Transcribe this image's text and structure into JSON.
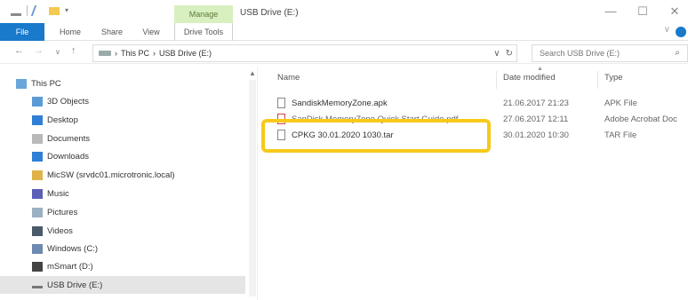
{
  "window": {
    "title": "USB Drive (E:)",
    "manage_tab": "Manage",
    "minimize": "—",
    "maximize": "☐",
    "close": "✕"
  },
  "ribbon": {
    "tabs": [
      "File",
      "Home",
      "Share",
      "View",
      "Drive Tools"
    ],
    "expand": "∨"
  },
  "address": {
    "crumbs": [
      "This PC",
      "USB Drive (E:)"
    ],
    "separator": "›",
    "dropdown": "∨",
    "refresh": "↻"
  },
  "search": {
    "placeholder": "Search USB Drive (E:)",
    "icon": "⌕"
  },
  "navigation": {
    "items": [
      {
        "label": "This PC",
        "icon": "this-pc-icon"
      },
      {
        "label": "3D Objects",
        "icon": "3d-objects-icon"
      },
      {
        "label": "Desktop",
        "icon": "desktop-icon"
      },
      {
        "label": "Documents",
        "icon": "documents-icon"
      },
      {
        "label": "Downloads",
        "icon": "downloads-icon"
      },
      {
        "label": "MicSW (srvdc01.microtronic.local)",
        "icon": "network-drive-icon"
      },
      {
        "label": "Music",
        "icon": "music-icon"
      },
      {
        "label": "Pictures",
        "icon": "pictures-icon"
      },
      {
        "label": "Videos",
        "icon": "videos-icon"
      },
      {
        "label": "Windows (C:)",
        "icon": "windows-drive-icon"
      },
      {
        "label": "mSmart (D:)",
        "icon": "drive-icon"
      },
      {
        "label": "USB Drive (E:)",
        "icon": "usb-drive-icon"
      }
    ]
  },
  "columns": {
    "name": "Name",
    "date": "Date modified",
    "type": "Type"
  },
  "files": [
    {
      "name": "SandiskMemoryZone.apk",
      "date": "21.06.2017 21:23",
      "type": "APK File",
      "icon": "file-icon"
    },
    {
      "name": "SanDisk MemoryZone Quick Start Guide.pdf",
      "date": "27.06.2017 12:11",
      "type": "Adobe Acrobat Doc",
      "icon": "pdf-icon"
    },
    {
      "name": "CPKG 30.01.2020 1030.tar",
      "date": "30.01.2020 10:30",
      "type": "TAR File",
      "icon": "file-icon"
    }
  ],
  "colors": {
    "accent": "#1979ca",
    "manage": "#d8f0c0",
    "highlight": "#f7c91b",
    "selected": "#e5e5e5"
  }
}
